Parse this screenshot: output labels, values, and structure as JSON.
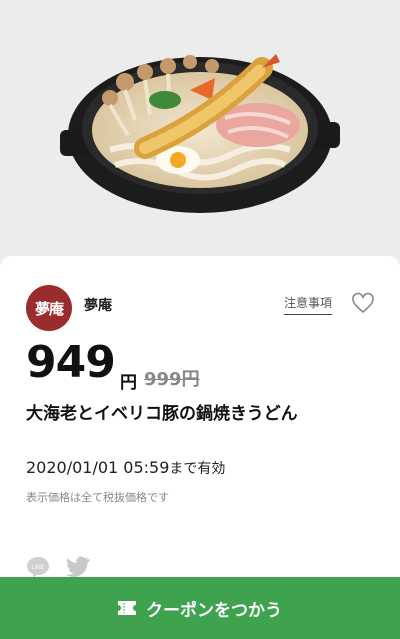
{
  "shop": {
    "name": "夢庵",
    "logo_text": "夢庵",
    "color": "#9b2c2e"
  },
  "notes_label": "注意事項",
  "price": {
    "current": "949",
    "unit": "円",
    "original": "999円"
  },
  "product": {
    "title": "大海老とイベリコ豚の鍋焼きうどん"
  },
  "validity": {
    "datetime": "2020/01/01 05:59",
    "suffix": "まで有効"
  },
  "tax_note": "表示価格は全て税抜価格です",
  "share": {
    "line_label": "LINE"
  },
  "coupon_button": {
    "label": "クーポンをつかう",
    "color": "#3fa24f"
  },
  "icons": [
    "nabe-udon-image",
    "heart-icon",
    "line-icon",
    "twitter-icon",
    "ticket-icon"
  ]
}
